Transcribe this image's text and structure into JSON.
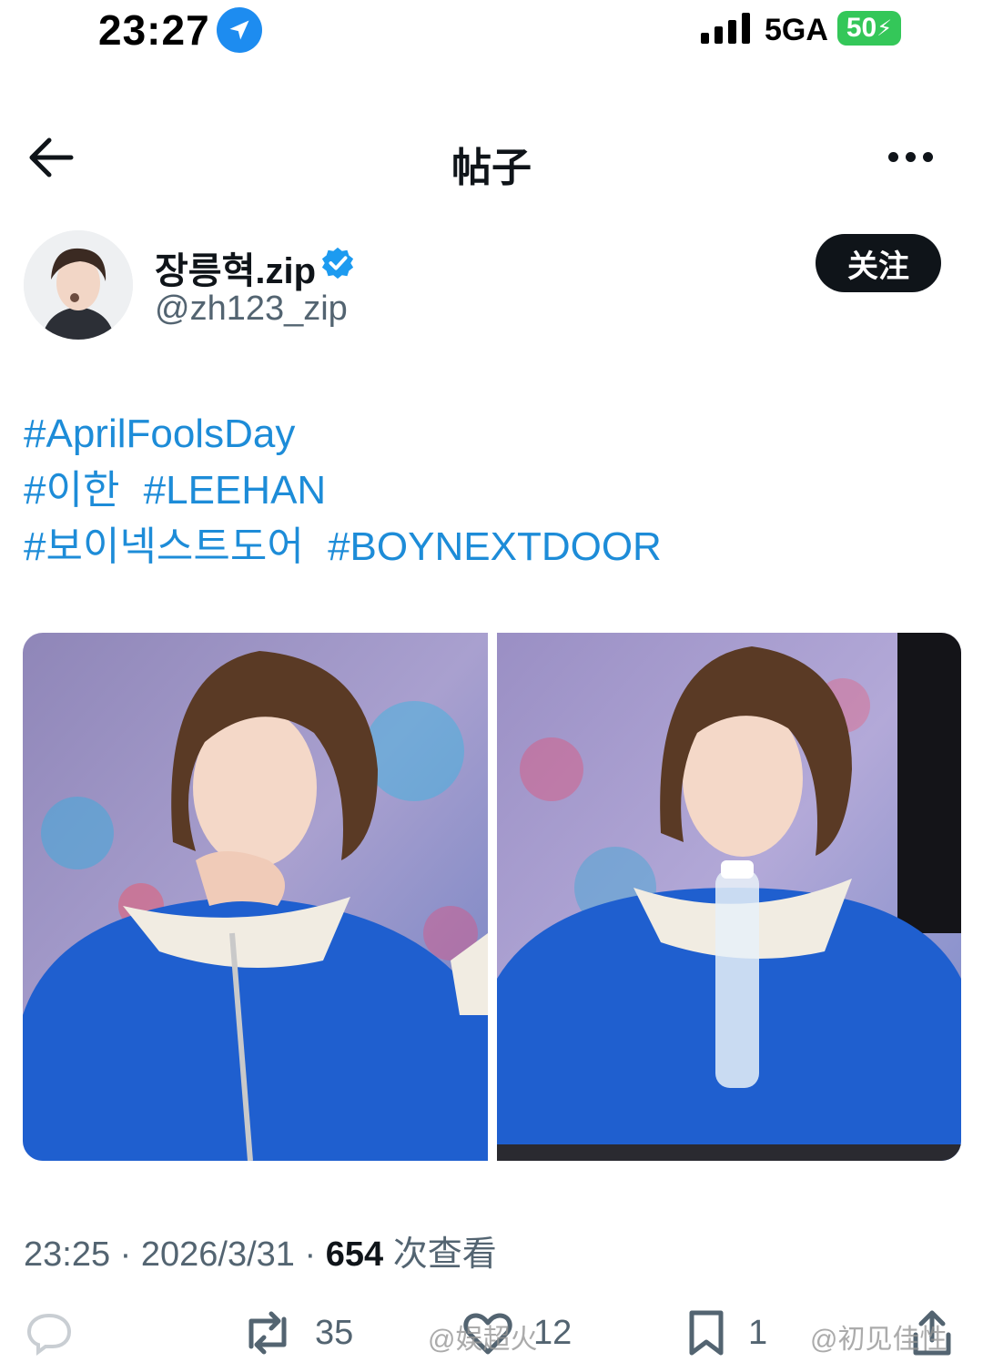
{
  "status_bar": {
    "time": "23:27",
    "network": "5GA",
    "battery": "50"
  },
  "nav": {
    "title": "帖子"
  },
  "author": {
    "display_name": "장릉혁.zip",
    "handle": "@zh123_zip",
    "follow_label": "关注"
  },
  "post": {
    "hashtags": [
      [
        "#AprilFoolsDay"
      ],
      [
        "#이한",
        "#LEEHAN"
      ],
      [
        "#보이넥스트도어",
        "#BOYNEXTDOOR"
      ]
    ],
    "time": "23:25",
    "date": "2026/3/31",
    "views": "654",
    "views_label": "次查看"
  },
  "actions": {
    "reply": "",
    "retweet": "35",
    "like": "12",
    "bookmark": "1"
  },
  "watermarks": {
    "left": "@娱超火",
    "right": "@初见佳性"
  },
  "colors": {
    "link": "#1d8cd8",
    "muted": "#536471",
    "text": "#0f1419",
    "verified": "#1d9bf0",
    "battery": "#34c759"
  }
}
